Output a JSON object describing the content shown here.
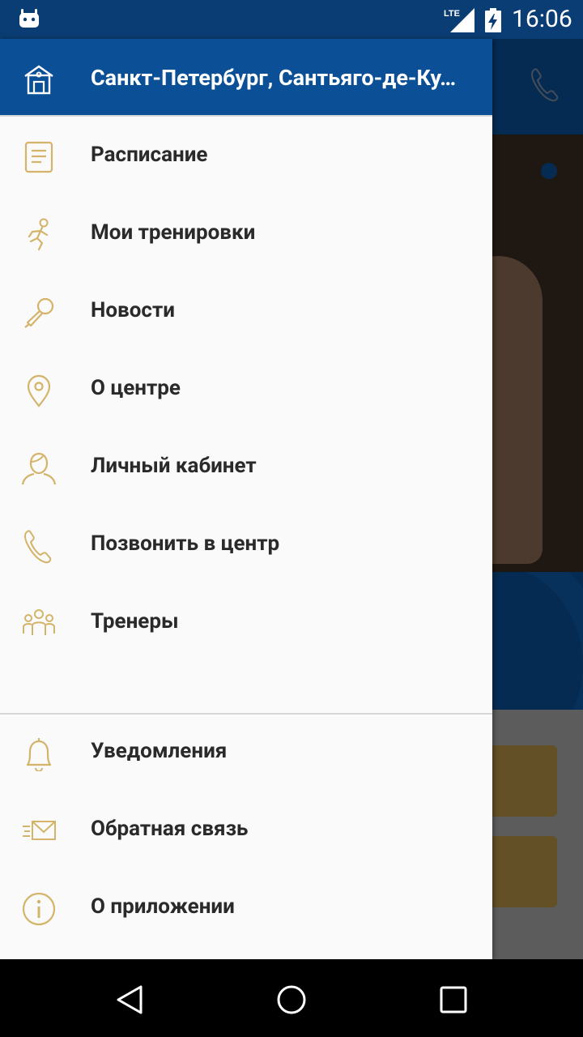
{
  "status_bar": {
    "time": "16:06",
    "network": "LTE"
  },
  "drawer": {
    "header_title": "Санкт-Петербург, Сантьяго-де-Ку…",
    "primary_items": [
      {
        "label": "Расписание",
        "icon": "schedule-icon"
      },
      {
        "label": "Мои тренировки",
        "icon": "runner-icon"
      },
      {
        "label": "Новости",
        "icon": "microphone-icon"
      },
      {
        "label": "О центре",
        "icon": "location-pin-icon"
      },
      {
        "label": "Личный кабинет",
        "icon": "user-icon"
      },
      {
        "label": "Позвонить в центр",
        "icon": "phone-icon"
      },
      {
        "label": "Тренеры",
        "icon": "group-icon"
      }
    ],
    "secondary_items": [
      {
        "label": "Уведомления",
        "icon": "bell-icon"
      },
      {
        "label": "Обратная связь",
        "icon": "envelope-icon"
      },
      {
        "label": "О приложении",
        "icon": "info-icon"
      }
    ]
  },
  "colors": {
    "primary": "#0b4f96",
    "status_bar": "#0a3d73",
    "icon_gold": "#d4b46a",
    "text": "#2a2a2a"
  }
}
